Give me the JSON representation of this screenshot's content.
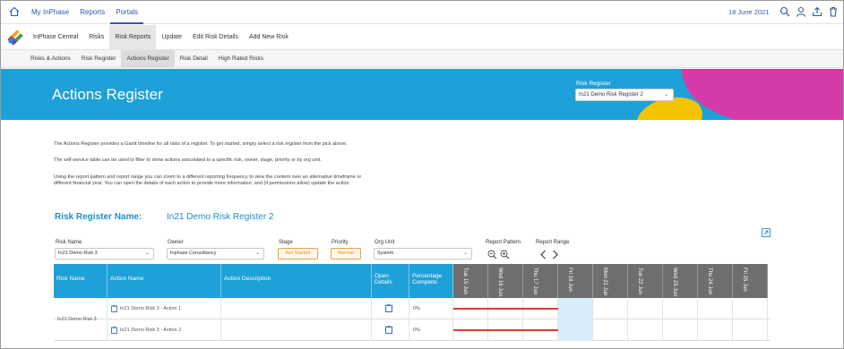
{
  "topbar": {
    "nav": [
      "My InPhase",
      "Reports",
      "Portals"
    ],
    "active": "Portals",
    "date": "18 June 2021",
    "icons": [
      "search-icon",
      "user-icon",
      "upload-icon",
      "trash-icon"
    ]
  },
  "app": {
    "name": "InPhase Central",
    "nav": [
      "Risks",
      "Risk Reports",
      "Update",
      "Edit Risk Details",
      "Add New Risk"
    ],
    "active": "Risk Reports"
  },
  "subnav": {
    "items": [
      "Risks & Actions",
      "Risk Register",
      "Actions Register",
      "Risk Detail",
      "High Rated Risks"
    ],
    "active": "Actions Register"
  },
  "banner": {
    "title": "Actions Register",
    "register_label": "Risk Register",
    "register_value": "In21 Demo Risk Register 2",
    "colors": {
      "blue": "#1ea0d8",
      "magenta": "#d63aa8",
      "yellow": "#f5c400"
    }
  },
  "intro": {
    "p1": "The Actions Register provides a Gantt timeline for all risks of a register. To get started, simply select a risk register from the pick above.",
    "p2": "The self-service table can be used to filter to show actions asscoiated to a specific risk, owner, stage, priority or by org unit.",
    "p3a": "Using the report pattern and report range you can zoom to a different reporting frequency to view the content over an alternative timeframe or",
    "p3b": "different financial year. You can open the details of each action to provide more information, and (if permissions allow) update the action."
  },
  "register": {
    "label": "Risk Register Name:",
    "value": "In21 Demo Risk Register 2"
  },
  "filters": {
    "risk_name_label": "Risk Name",
    "risk_name_value": "In21 Demo Risk 3",
    "owner_label": "Owner",
    "owner_value": "Inphase Consultancy",
    "stage_label": "Stage",
    "stage_value": "Not Started",
    "priority_label": "Priority",
    "priority_value": "Normal",
    "org_label": "Org Unit",
    "org_value": "System",
    "pattern_label": "Report Pattern",
    "range_label": "Report Range"
  },
  "table": {
    "headers": {
      "risk_name": "Risk Name",
      "action_name": "Action Name",
      "action_desc": "Action Description",
      "open_details": "Open Details",
      "pct": "Percentage Complete"
    },
    "dates": [
      "Tue 15 Jun",
      "Wed 16 Jun",
      "Thu 17 Jun",
      "Fri 18 Jun",
      "Mon 21 Jun",
      "Tue 22 Jun",
      "Wed 23 Jun",
      "Thu 24 Jun",
      "Fri 25 Jun"
    ],
    "today_index": 3,
    "risk": "In21 Demo Risk 3",
    "rows": [
      {
        "action": "In21 Demo Risk 3 - Action 1",
        "desc": "",
        "pct": "0%"
      },
      {
        "action": "In21 Demo Risk 3 - Action 2",
        "desc": "",
        "pct": "0%"
      }
    ]
  }
}
